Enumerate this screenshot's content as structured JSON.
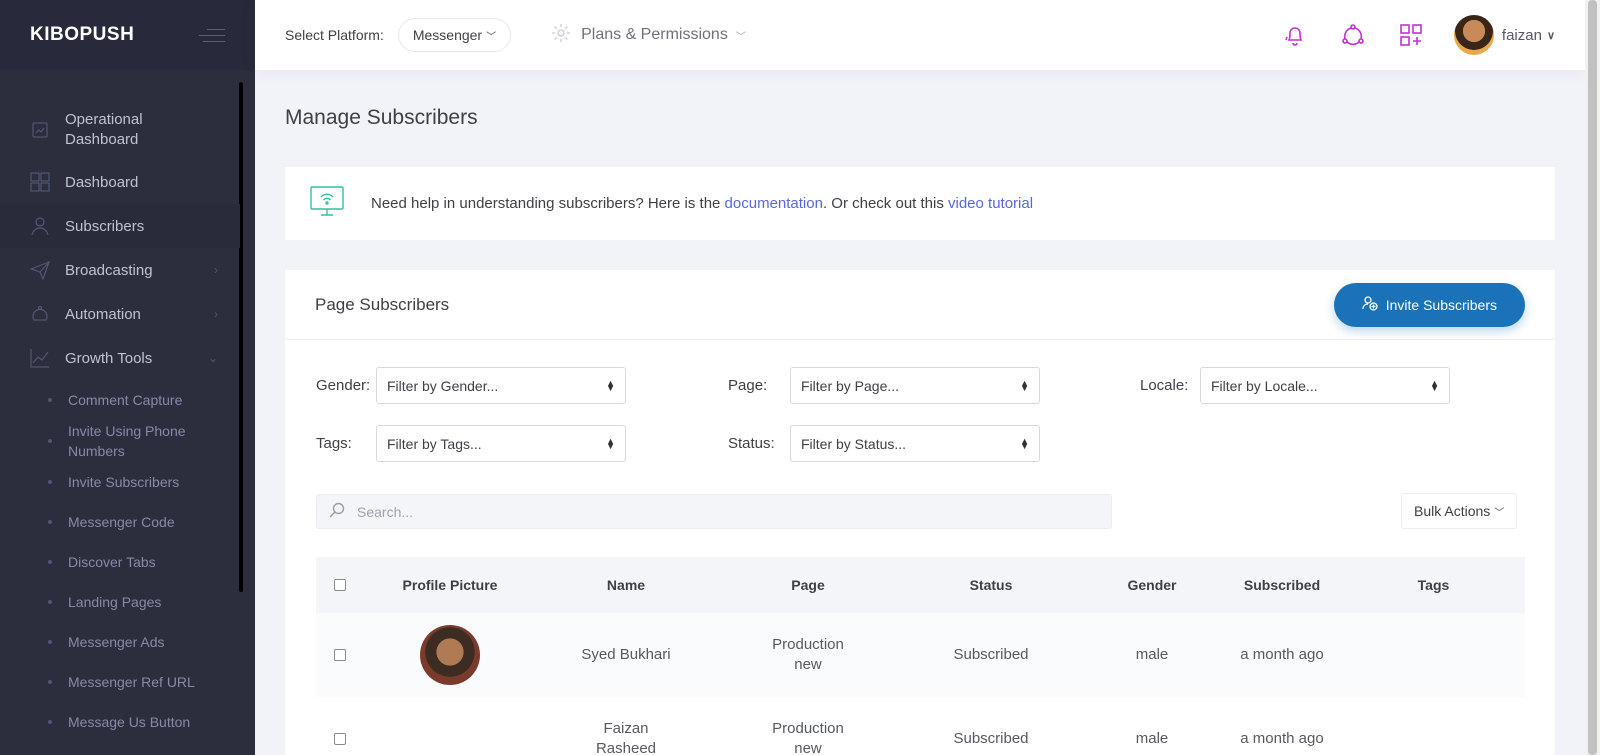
{
  "brand": "KIBOPUSH",
  "sidebar": {
    "items": [
      {
        "label": "Operational Dashboard",
        "icon": "operational-dashboard-icon"
      },
      {
        "label": "Dashboard",
        "icon": "dashboard-grid-icon"
      },
      {
        "label": "Subscribers",
        "icon": "user-icon"
      },
      {
        "label": "Broadcasting",
        "icon": "paper-plane-icon"
      },
      {
        "label": "Automation",
        "icon": "automation-icon"
      },
      {
        "label": "Growth Tools",
        "icon": "chart-line-icon"
      }
    ],
    "growth_tools": [
      "Comment Capture",
      "Invite Using Phone Numbers",
      "Invite Subscribers",
      "Messenger Code",
      "Discover Tabs",
      "Landing Pages",
      "Messenger Ads",
      "Messenger Ref URL",
      "Message Us Button"
    ]
  },
  "header": {
    "platform_label": "Select Platform:",
    "platform_value": "Messenger",
    "plans_label": "Plans & Permissions",
    "user_name": "faizan"
  },
  "page": {
    "title": "Manage Subscribers",
    "help_prefix": "Need help in understanding subscribers? Here is the ",
    "help_link1": "documentation",
    "help_middle": ". Or check out this ",
    "help_link2": "video tutorial"
  },
  "portlet": {
    "title": "Page Subscribers",
    "invite_label": "Invite Subscribers"
  },
  "filters": {
    "gender_label": "Gender:",
    "gender_value": "Filter by Gender...",
    "page_label": "Page:",
    "page_value": "Filter by Page...",
    "locale_label": "Locale:",
    "locale_value": "Filter by Locale...",
    "tags_label": "Tags:",
    "tags_value": "Filter by Tags...",
    "status_label": "Status:",
    "status_value": "Filter by Status..."
  },
  "search": {
    "placeholder": "Search..."
  },
  "bulk_actions": "Bulk Actions",
  "table": {
    "headers": [
      "Profile Picture",
      "Name",
      "Page",
      "Status",
      "Gender",
      "Subscribed",
      "Tags"
    ],
    "rows": [
      {
        "name": "Syed Bukhari",
        "page": "Production new",
        "status": "Subscribed",
        "gender": "male",
        "subscribed": "a month ago"
      },
      {
        "name": "Faizan Rasheed",
        "page": "Production new",
        "status": "Subscribed",
        "gender": "male",
        "subscribed": "a month ago"
      }
    ]
  },
  "colors": {
    "sidebar": "#2c2e3e",
    "accent": "#1a73b8",
    "link": "#5867dd",
    "help_icon": "#34bfa3",
    "header_icons": "#c62fd6"
  }
}
